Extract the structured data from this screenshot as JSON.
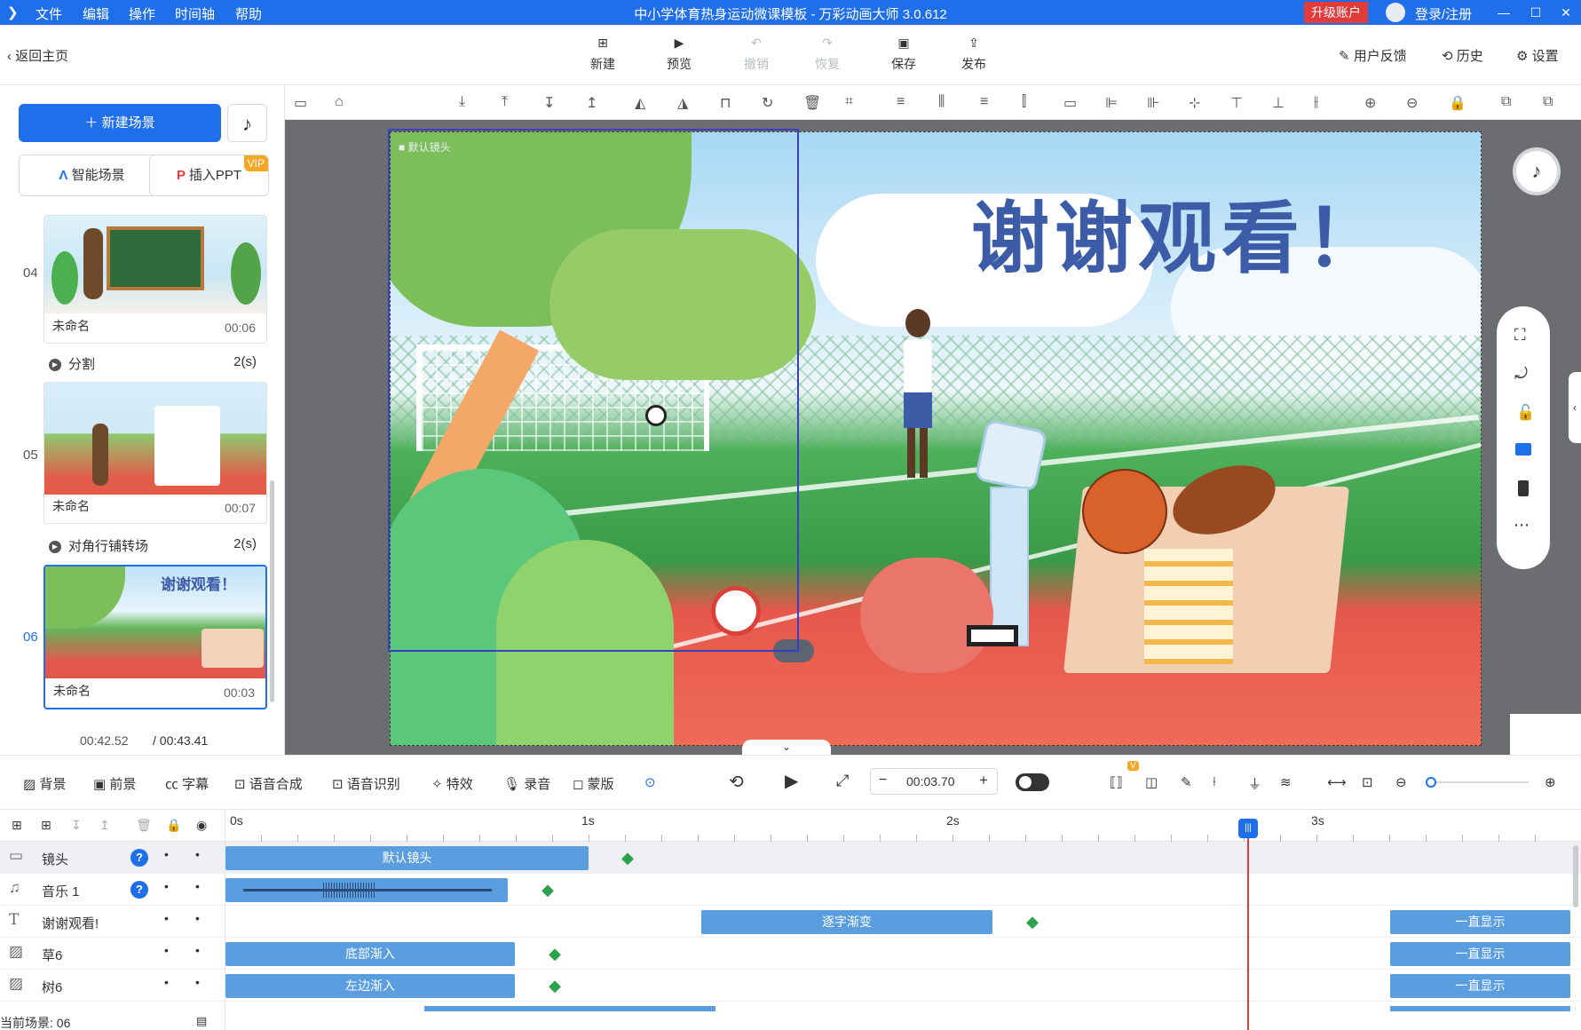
{
  "window": {
    "title": "中小学体育热身运动微课模板 - 万彩动画大师 3.0.612",
    "menu": [
      "文件",
      "编辑",
      "操作",
      "时间轴",
      "帮助"
    ],
    "upgrade": "升级账户",
    "login": "登录/注册"
  },
  "toolbar": {
    "back": "返回主页",
    "new": "新建",
    "preview": "预览",
    "undo": "撤销",
    "redo": "恢复",
    "save": "保存",
    "publish": "发布",
    "feedback": "用户反馈",
    "history": "历史",
    "settings": "设置"
  },
  "left": {
    "new_scene": "新建场景",
    "smart_scene": "智能场景",
    "insert_ppt": "插入PPT",
    "vip": "VIP",
    "scenes": [
      {
        "num": "04",
        "name": "未命名",
        "time": "00:06"
      },
      {
        "num": "05",
        "name": "未命名",
        "time": "00:07"
      },
      {
        "num": "06",
        "name": "未命名",
        "time": "00:03"
      }
    ],
    "transitions": [
      {
        "name": "分割",
        "dur": "2(s)"
      },
      {
        "name": "对角行铺转场",
        "dur": "2(s)"
      }
    ],
    "current_time": "00:42.52",
    "total_time": "/ 00:43.41"
  },
  "canvas": {
    "camera_label": "默认镜头",
    "headline": "谢谢观看！",
    "thumb_headline": "谢谢观看！"
  },
  "timeline_bar": {
    "items": [
      "背景",
      "前景",
      "字幕",
      "语音合成",
      "语音识别",
      "特效",
      "录音",
      "蒙版"
    ],
    "time_value": "00:03.70",
    "v_badge": "V"
  },
  "timeline": {
    "ruler": [
      "0s",
      "1s",
      "2s",
      "3s"
    ],
    "tracks": [
      {
        "name": "镜头",
        "clips": [
          "默认镜头"
        ]
      },
      {
        "name": "音乐 1",
        "clips": []
      },
      {
        "name": "谢谢观看!",
        "clips": [
          "逐字渐变",
          "一直显示"
        ]
      },
      {
        "name": "草6",
        "clips": [
          "底部渐入",
          "一直显示"
        ]
      },
      {
        "name": "树6",
        "clips": [
          "左边渐入",
          "一直显示"
        ]
      }
    ],
    "current_scene": "当前场景: 06"
  },
  "colors": {
    "accent": "#1f6feb",
    "upgrade": "#e23b3b",
    "keyframe": "#2ca24b",
    "clip": "#5a9ee0"
  }
}
